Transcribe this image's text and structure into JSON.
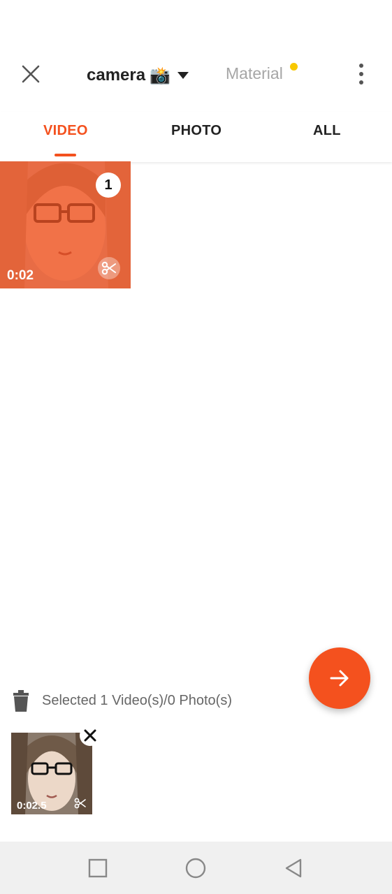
{
  "header": {
    "album_name": "camera",
    "album_emoji": "📸",
    "material_label": "Material"
  },
  "tabs": [
    {
      "label": "VIDEO",
      "active": true
    },
    {
      "label": "PHOTO",
      "active": false
    },
    {
      "label": "ALL",
      "active": false
    }
  ],
  "grid": {
    "items": [
      {
        "selection_number": "1",
        "duration": "0:02",
        "tint": "#f4511e"
      }
    ]
  },
  "selection": {
    "summary": "Selected 1 Video(s)/0 Photo(s)",
    "items": [
      {
        "duration": "0:02.5"
      }
    ]
  },
  "colors": {
    "accent": "#f4511e",
    "badge_dot": "#f8c800"
  },
  "icons": {
    "close": "close-icon",
    "dropdown": "caret-down-icon",
    "more": "more-vertical-icon",
    "trim": "scissors-icon",
    "next": "arrow-right-icon",
    "delete": "trash-icon",
    "remove": "close-icon"
  }
}
